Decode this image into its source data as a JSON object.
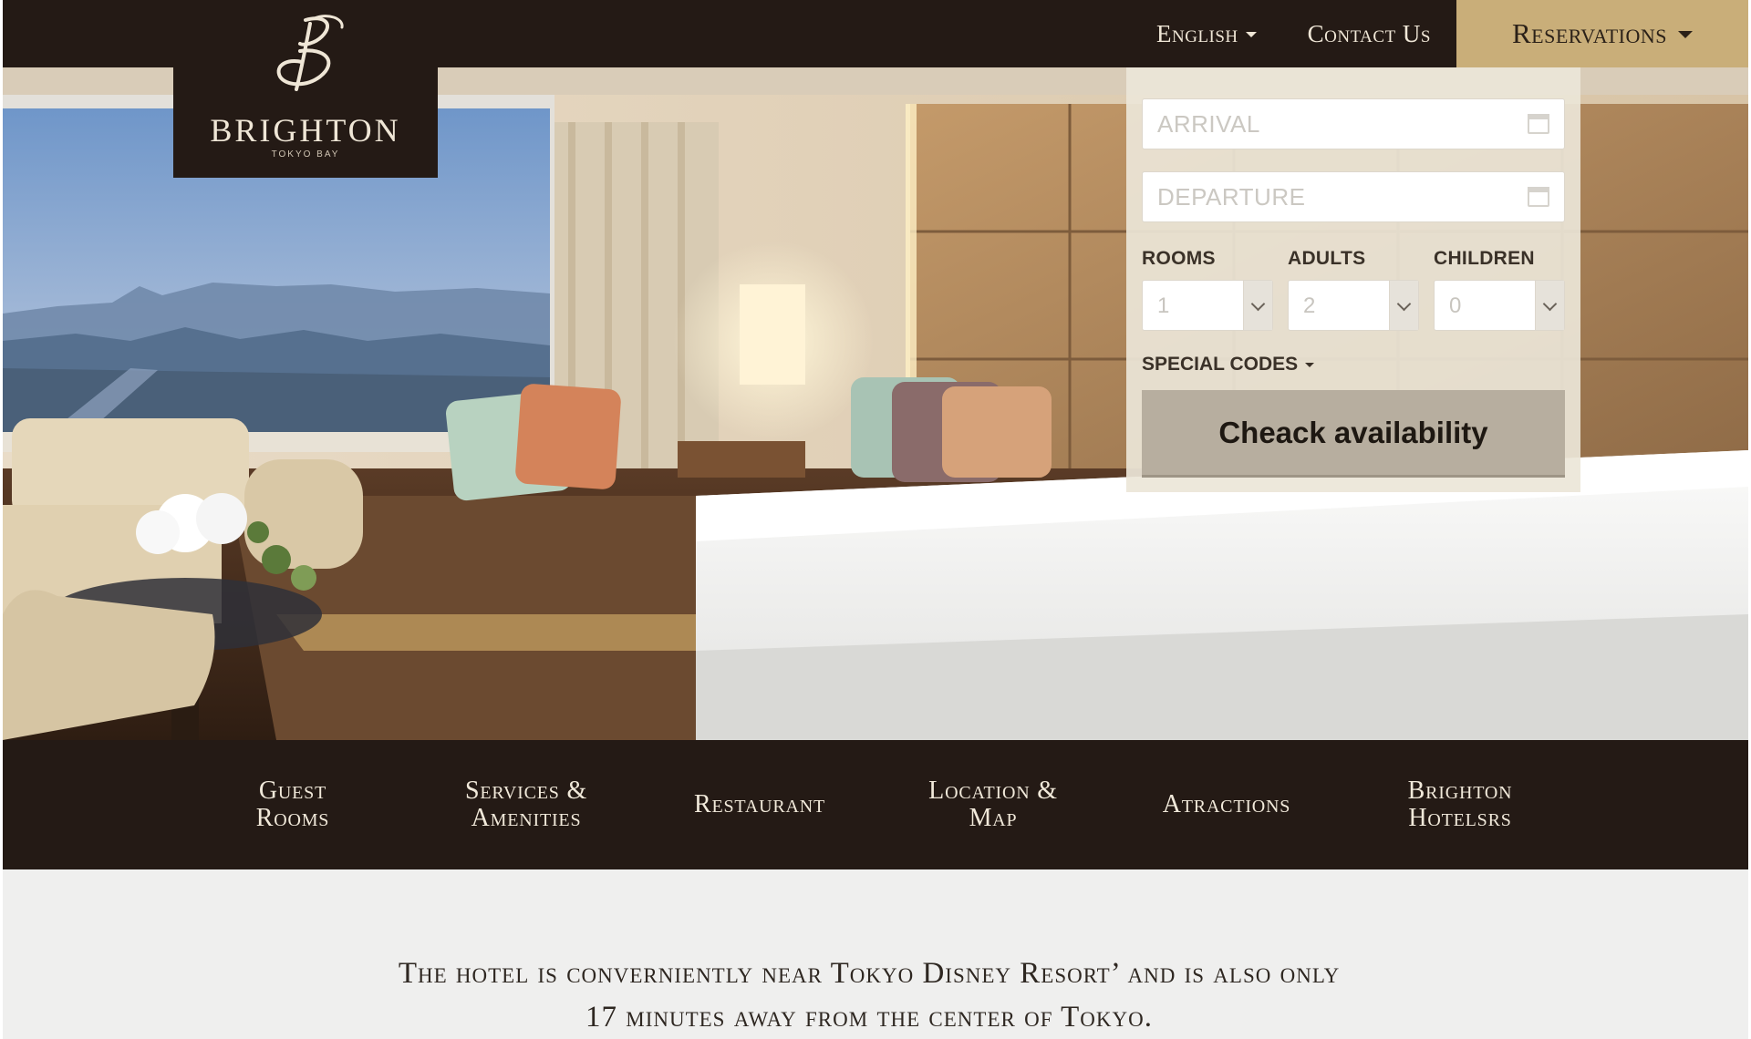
{
  "brand": {
    "name": "BRIGHTON",
    "sub": "TOKYO BAY"
  },
  "topnav": {
    "language": "English",
    "contact": "Contact Us",
    "reservations": "Reservations"
  },
  "reservation": {
    "arrival_placeholder": "ARRIVAL",
    "departure_placeholder": "DEPARTURE",
    "rooms_label": "ROOMS",
    "rooms_value": "1",
    "adults_label": "ADULTS",
    "adults_value": "2",
    "children_label": "CHILDREN",
    "children_value": "0",
    "special_codes": "SPECIAL CODES",
    "check_button": "Cheack availability"
  },
  "mainnav": [
    {
      "label": "Guest\nRooms"
    },
    {
      "label": "Services &\nAmenities"
    },
    {
      "label": "Restaurant"
    },
    {
      "label": "Location &\nMap"
    },
    {
      "label": "Atractions"
    },
    {
      "label": "Brighton\nHotelsrs"
    }
  ],
  "intro": {
    "text": "The hotel is converniently near Tokyo Disney Resort’ and is also only 17 minutes away from the center of Tokyo."
  },
  "colors": {
    "dark": "#241a15",
    "gold": "#c9ae79",
    "panel": "#ece6d8",
    "button": "#b7ae9f"
  }
}
